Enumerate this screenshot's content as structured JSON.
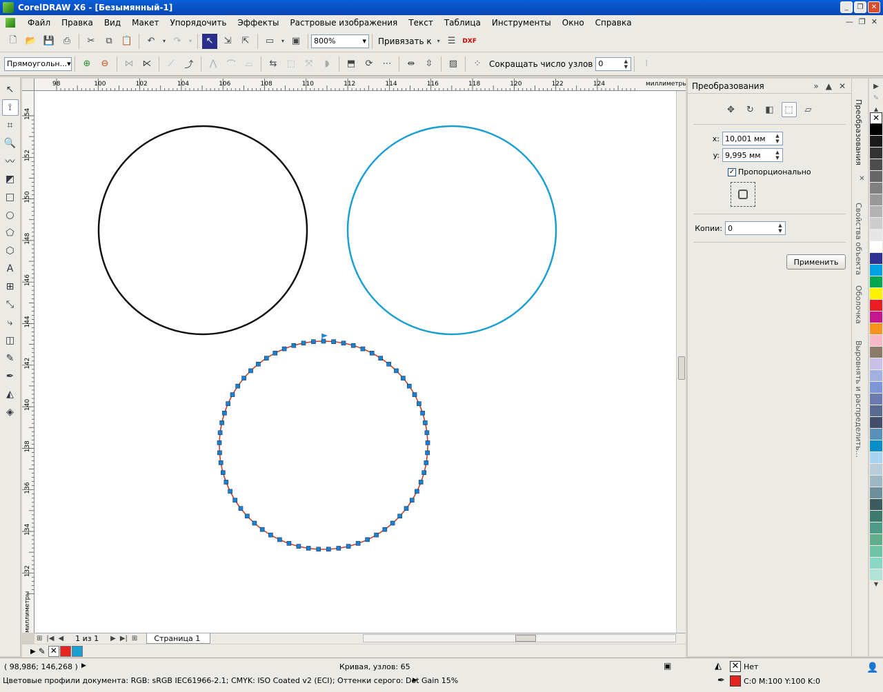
{
  "window": {
    "title": "CorelDRAW X6 - [Безымянный-1]"
  },
  "menu": {
    "items": [
      "Файл",
      "Правка",
      "Вид",
      "Макет",
      "Упорядочить",
      "Эффекты",
      "Растровые изображения",
      "Текст",
      "Таблица",
      "Инструменты",
      "Окно",
      "Справка"
    ]
  },
  "toolbar1": {
    "zoom_value": "800%",
    "snap_label": "Привязать к",
    "dxf_label": "DXF"
  },
  "toolbar2": {
    "shape_select": "Прямоугольн...",
    "reduce_nodes_label": "Сокращать число узлов",
    "reduce_nodes_value": "0"
  },
  "rulers": {
    "h_ticks": [
      "98",
      "100",
      "102",
      "104",
      "106",
      "108",
      "110",
      "112",
      "114",
      "116",
      "118",
      "120",
      "122",
      "124"
    ],
    "h_unit": "миллиметры",
    "v_ticks": [
      "154",
      "152",
      "150",
      "148",
      "146",
      "144",
      "142",
      "140",
      "138",
      "136",
      "134",
      "132"
    ],
    "v_unit": "миллиметры"
  },
  "canvas": {
    "circle1_color": "#111111",
    "circle2_color": "#1a9fd0",
    "circle3_color": "#c8391f",
    "node_color": "#1f7fcf",
    "node_count": 65
  },
  "pagebar": {
    "page_counter": "1 из 1",
    "page_tab": "Страница 1"
  },
  "docker": {
    "title": "Преобразования",
    "x_label": "x:",
    "x_value": "10,001 мм",
    "y_label": "y:",
    "y_value": "9,995 мм",
    "proportional_label": "Пропорционально",
    "copies_label": "Копии:",
    "copies_value": "0",
    "apply_label": "Применить"
  },
  "vtabs": {
    "tab1": "Преобразования",
    "tab2": "Свойства объекта",
    "tab3": "Оболочка",
    "tab4": "Выровнять и распределить..."
  },
  "palette": {
    "colors": [
      "#000000",
      "#1a1a1a",
      "#333333",
      "#4d4d4d",
      "#666666",
      "#808080",
      "#999999",
      "#b3b3b3",
      "#cccccc",
      "#e6e6e6",
      "#ffffff",
      "#2e3192",
      "#00a0e3",
      "#00a650",
      "#fff200",
      "#ed1c24",
      "#c6168d",
      "#f7941d",
      "#f7b9c7",
      "#8c7b6b",
      "#c9c1e8",
      "#a3b1e0",
      "#7f96d6",
      "#6b7bb0",
      "#5a6a90",
      "#434e6a",
      "#5a8fb8",
      "#0a8ec8",
      "#a9d4ef",
      "#b8cfd9",
      "#9fb7c2",
      "#6c8f99",
      "#3d5a5f",
      "#3d7a6e",
      "#4e9a86",
      "#63ad8f",
      "#6fc4a8",
      "#8ad6c4",
      "#b3e2d7"
    ]
  },
  "status": {
    "coords": "( 98,986; 146,268 )",
    "object_info": "Кривая, узлов: 65",
    "color_profiles": "Цветовые профили документа: RGB: sRGB IEC61966-2.1; CMYK: ISO Coated v2 (ECI); Оттенки серого: Dot Gain 15%",
    "fill_label": "Нет",
    "outline_label": "C:0 M:100 Y:100 K:0",
    "outline_color": "#e32620"
  }
}
